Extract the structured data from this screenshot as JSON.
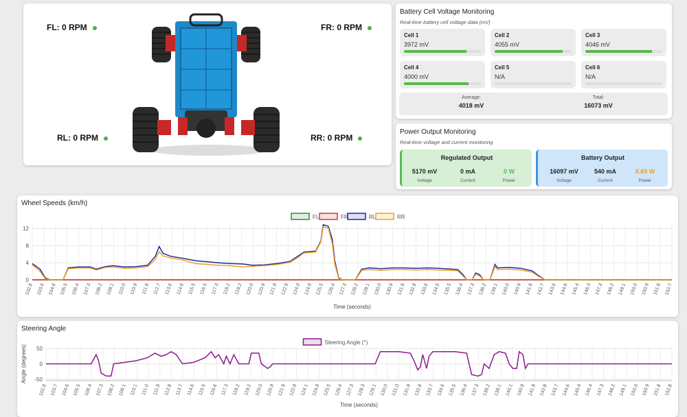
{
  "car": {
    "fl": "FL: 0 RPM",
    "fr": "FR: 0 RPM",
    "rl": "RL: 0 RPM",
    "rr": "RR: 0 RPM"
  },
  "battery": {
    "title": "Battery Cell Voltage Monitoring",
    "subtitle": "Real-time battery cell voltage data (mV)",
    "cells": [
      {
        "name": "Cell 1",
        "value": "3972 mV",
        "fill": 0.81
      },
      {
        "name": "Cell 2",
        "value": "4055 mV",
        "fill": 0.88
      },
      {
        "name": "Cell 3",
        "value": "4046 mV",
        "fill": 0.87
      },
      {
        "name": "Cell 4",
        "value": "4000 mV",
        "fill": 0.84
      },
      {
        "name": "Cell 5",
        "value": "N/A",
        "fill": 0
      },
      {
        "name": "Cell 6",
        "value": "N/A",
        "fill": 0
      }
    ],
    "average_label": "Average:",
    "average_value": "4018 mV",
    "total_label": "Total:",
    "total_value": "16073 mV"
  },
  "power": {
    "title": "Power Output Monitoring",
    "subtitle": "Real-time voltage and current monitoring",
    "regulated": {
      "title": "Regulated Output",
      "voltage": "5170 mV",
      "voltage_label": "Voltage",
      "current": "0 mA",
      "current_label": "Current",
      "power": "0 W",
      "power_label": "Power",
      "power_color": "#5cb85c"
    },
    "battery_out": {
      "title": "Battery Output",
      "voltage": "16097 mV",
      "voltage_label": "Voltage",
      "current": "540 mA",
      "current_label": "Current",
      "power": "8.69 W",
      "power_label": "Power",
      "power_color": "#f0a020"
    }
  },
  "wheel_chart": {
    "title": "Wheel Speeds (km/h)",
    "xlabel": "Time (seconds)",
    "chart_data": {
      "type": "line",
      "xlabel": "Time (seconds)",
      "ylim": [
        0,
        13
      ],
      "yticks": [
        0,
        4,
        8,
        12
      ],
      "xtick_labels": [
        "102.8",
        "103.6",
        "104.6",
        "105.5",
        "106.4",
        "107.3",
        "108.2",
        "109.1",
        "110.0",
        "110.9",
        "111.8",
        "112.7",
        "113.6",
        "114.6",
        "115.5",
        "116.5",
        "117.3",
        "118.2",
        "119.2",
        "120.0",
        "120.9",
        "121.9",
        "122.9",
        "124.0",
        "124.9",
        "125.5",
        "126.4",
        "127.3",
        "128.2",
        "129.1",
        "130.0",
        "130.9",
        "131.8",
        "132.8",
        "133.6",
        "134.5",
        "135.5",
        "136.4",
        "137.3",
        "138.2",
        "139.1",
        "140.0",
        "140.9",
        "141.8",
        "142.7",
        "143.6",
        "144.6",
        "145.4",
        "146.3",
        "147.3",
        "148.2",
        "149.1",
        "150.0",
        "150.9",
        "151.8",
        "152.7"
      ],
      "series": [
        {
          "name": "FL",
          "color": "#2e8b3a",
          "points": [
            [
              102.8,
              0
            ],
            [
              152.7,
              0
            ]
          ]
        },
        {
          "name": "FR",
          "color": "#d9363e",
          "points": [
            [
              102.8,
              0
            ],
            [
              152.7,
              0
            ]
          ]
        },
        {
          "name": "RL",
          "color": "#1f2a9c",
          "points": [
            [
              102.8,
              3.8
            ],
            [
              103.4,
              2.5
            ],
            [
              103.8,
              0.5
            ],
            [
              104.2,
              0
            ],
            [
              105.2,
              0
            ],
            [
              105.6,
              2.8
            ],
            [
              106.4,
              3.0
            ],
            [
              107.3,
              3.0
            ],
            [
              107.8,
              2.5
            ],
            [
              108.5,
              3.1
            ],
            [
              109.1,
              3.3
            ],
            [
              110.0,
              3.0
            ],
            [
              110.9,
              3.1
            ],
            [
              111.8,
              3.4
            ],
            [
              112.4,
              5.5
            ],
            [
              112.7,
              7.8
            ],
            [
              113.0,
              6.2
            ],
            [
              113.6,
              5.5
            ],
            [
              114.6,
              5.0
            ],
            [
              115.5,
              4.5
            ],
            [
              116.5,
              4.2
            ],
            [
              117.3,
              4.0
            ],
            [
              118.2,
              3.8
            ],
            [
              119.2,
              3.7
            ],
            [
              120.0,
              3.4
            ],
            [
              120.9,
              3.5
            ],
            [
              121.9,
              3.8
            ],
            [
              122.9,
              4.3
            ],
            [
              123.5,
              5.5
            ],
            [
              124.0,
              6.5
            ],
            [
              124.9,
              6.7
            ],
            [
              125.3,
              9.0
            ],
            [
              125.5,
              12.9
            ],
            [
              125.9,
              12.5
            ],
            [
              126.2,
              9.5
            ],
            [
              126.4,
              4.5
            ],
            [
              126.7,
              0.5
            ],
            [
              127.0,
              0
            ],
            [
              128.0,
              0
            ],
            [
              128.5,
              2.5
            ],
            [
              129.1,
              2.8
            ],
            [
              130.0,
              2.6
            ],
            [
              130.9,
              2.8
            ],
            [
              131.8,
              2.8
            ],
            [
              132.8,
              2.7
            ],
            [
              133.6,
              2.8
            ],
            [
              134.5,
              2.7
            ],
            [
              135.5,
              2.5
            ],
            [
              136.0,
              2.4
            ],
            [
              136.4,
              1.2
            ],
            [
              136.7,
              0
            ],
            [
              137.1,
              0
            ],
            [
              137.4,
              1.6
            ],
            [
              137.7,
              1.2
            ],
            [
              138.0,
              0
            ],
            [
              138.5,
              0
            ],
            [
              138.9,
              3.6
            ],
            [
              139.1,
              2.8
            ],
            [
              140.0,
              2.9
            ],
            [
              140.9,
              2.7
            ],
            [
              141.8,
              2.1
            ],
            [
              142.3,
              1.0
            ],
            [
              142.8,
              0
            ],
            [
              152.7,
              0
            ]
          ]
        },
        {
          "name": "RR",
          "color": "#f0a020",
          "points": [
            [
              102.8,
              3.5
            ],
            [
              103.4,
              2.0
            ],
            [
              103.8,
              0.3
            ],
            [
              104.2,
              0
            ],
            [
              105.2,
              0
            ],
            [
              105.6,
              2.6
            ],
            [
              106.4,
              2.8
            ],
            [
              107.3,
              2.8
            ],
            [
              107.8,
              2.3
            ],
            [
              108.5,
              2.9
            ],
            [
              109.1,
              3.0
            ],
            [
              110.0,
              2.7
            ],
            [
              110.9,
              2.8
            ],
            [
              111.8,
              3.1
            ],
            [
              112.4,
              4.8
            ],
            [
              112.7,
              6.6
            ],
            [
              113.0,
              5.6
            ],
            [
              113.6,
              5.1
            ],
            [
              114.6,
              4.6
            ],
            [
              115.5,
              3.8
            ],
            [
              116.5,
              3.6
            ],
            [
              117.3,
              3.4
            ],
            [
              118.2,
              3.3
            ],
            [
              119.2,
              3.0
            ],
            [
              120.0,
              3.2
            ],
            [
              120.9,
              3.3
            ],
            [
              121.9,
              3.6
            ],
            [
              122.9,
              4.1
            ],
            [
              123.5,
              5.2
            ],
            [
              124.0,
              6.3
            ],
            [
              124.9,
              6.5
            ],
            [
              125.3,
              8.8
            ],
            [
              125.5,
              12.4
            ],
            [
              125.9,
              12.1
            ],
            [
              126.2,
              8.5
            ],
            [
              126.4,
              3.8
            ],
            [
              126.7,
              0.3
            ],
            [
              127.0,
              0
            ],
            [
              128.0,
              0
            ],
            [
              128.5,
              2.2
            ],
            [
              129.1,
              2.4
            ],
            [
              130.0,
              2.2
            ],
            [
              130.9,
              2.4
            ],
            [
              131.8,
              2.4
            ],
            [
              132.8,
              2.3
            ],
            [
              133.6,
              2.4
            ],
            [
              134.5,
              2.3
            ],
            [
              135.5,
              2.2
            ],
            [
              136.0,
              2.1
            ],
            [
              136.4,
              0.9
            ],
            [
              136.7,
              0
            ],
            [
              137.1,
              0
            ],
            [
              137.4,
              1.3
            ],
            [
              137.7,
              0.9
            ],
            [
              138.0,
              0
            ],
            [
              138.5,
              0
            ],
            [
              138.9,
              3.1
            ],
            [
              139.1,
              2.4
            ],
            [
              140.0,
              2.5
            ],
            [
              140.9,
              2.3
            ],
            [
              141.8,
              1.8
            ],
            [
              142.3,
              0.8
            ],
            [
              142.8,
              0
            ],
            [
              152.7,
              0
            ]
          ]
        }
      ],
      "legend": "top-center",
      "grid": true
    }
  },
  "steer_chart": {
    "title": "Steering Angle",
    "ylabel": "Angle (degrees)",
    "xlabel": "Time (seconds)",
    "chart_data": {
      "type": "line",
      "ylabel": "Angle (degrees)",
      "xlabel": "Time (seconds)",
      "ylim": [
        -55,
        55
      ],
      "yticks": [
        -50,
        0,
        50
      ],
      "xtick_labels": [
        "102.8",
        "103.7",
        "104.6",
        "105.5",
        "106.4",
        "107.3",
        "108.2",
        "109.1",
        "110.1",
        "111.0",
        "111.9",
        "112.8",
        "113.7",
        "114.6",
        "115.5",
        "116.6",
        "117.3",
        "118.2",
        "119.2",
        "120.0",
        "120.9",
        "121.9",
        "122.9",
        "124.1",
        "124.9",
        "125.5",
        "126.4",
        "127.3",
        "128.3",
        "129.1",
        "130.0",
        "131.0",
        "131.9",
        "132.8",
        "133.7",
        "134.6",
        "135.5",
        "136.4",
        "137.3",
        "138.2",
        "139.1",
        "140.1",
        "140.9",
        "141.9",
        "142.8",
        "143.7",
        "144.6",
        "145.4",
        "146.4",
        "147.3",
        "148.2",
        "149.1",
        "150.0",
        "150.9",
        "151.8",
        "152.8"
      ],
      "series": [
        {
          "name": "Steering Angle (°)",
          "color": "#8b1a8b",
          "points": [
            [
              102.8,
              0
            ],
            [
              106.4,
              0
            ],
            [
              106.8,
              30
            ],
            [
              107.0,
              10
            ],
            [
              107.2,
              -30
            ],
            [
              107.6,
              -40
            ],
            [
              108.0,
              -40
            ],
            [
              108.2,
              0
            ],
            [
              109.1,
              5
            ],
            [
              110.0,
              10
            ],
            [
              110.9,
              20
            ],
            [
              111.5,
              35
            ],
            [
              112.0,
              25
            ],
            [
              112.4,
              30
            ],
            [
              112.8,
              40
            ],
            [
              113.2,
              30
            ],
            [
              113.7,
              0
            ],
            [
              114.6,
              5
            ],
            [
              115.5,
              20
            ],
            [
              116.0,
              40
            ],
            [
              116.3,
              20
            ],
            [
              116.6,
              30
            ],
            [
              117.0,
              0
            ],
            [
              117.2,
              25
            ],
            [
              117.5,
              0
            ],
            [
              117.8,
              30
            ],
            [
              118.2,
              0
            ],
            [
              119.0,
              0
            ],
            [
              119.2,
              35
            ],
            [
              119.8,
              35
            ],
            [
              120.0,
              0
            ],
            [
              120.5,
              -15
            ],
            [
              120.7,
              -10
            ],
            [
              120.9,
              0
            ],
            [
              129.1,
              0
            ],
            [
              129.5,
              40
            ],
            [
              130.0,
              40
            ],
            [
              131.0,
              40
            ],
            [
              131.9,
              35
            ],
            [
              132.2,
              10
            ],
            [
              132.5,
              -20
            ],
            [
              132.7,
              -10
            ],
            [
              132.9,
              30
            ],
            [
              133.2,
              -15
            ],
            [
              133.4,
              25
            ],
            [
              133.7,
              40
            ],
            [
              135.5,
              40
            ],
            [
              136.4,
              35
            ],
            [
              136.8,
              -35
            ],
            [
              137.3,
              -40
            ],
            [
              137.6,
              -35
            ],
            [
              137.8,
              0
            ],
            [
              138.2,
              -15
            ],
            [
              138.6,
              30
            ],
            [
              139.0,
              40
            ],
            [
              139.5,
              35
            ],
            [
              139.8,
              0
            ],
            [
              140.1,
              -15
            ],
            [
              140.4,
              -15
            ],
            [
              140.6,
              40
            ],
            [
              140.9,
              30
            ],
            [
              141.1,
              -15
            ],
            [
              141.3,
              0
            ],
            [
              152.8,
              0
            ]
          ]
        }
      ],
      "legend": "top-center",
      "grid": true
    }
  }
}
